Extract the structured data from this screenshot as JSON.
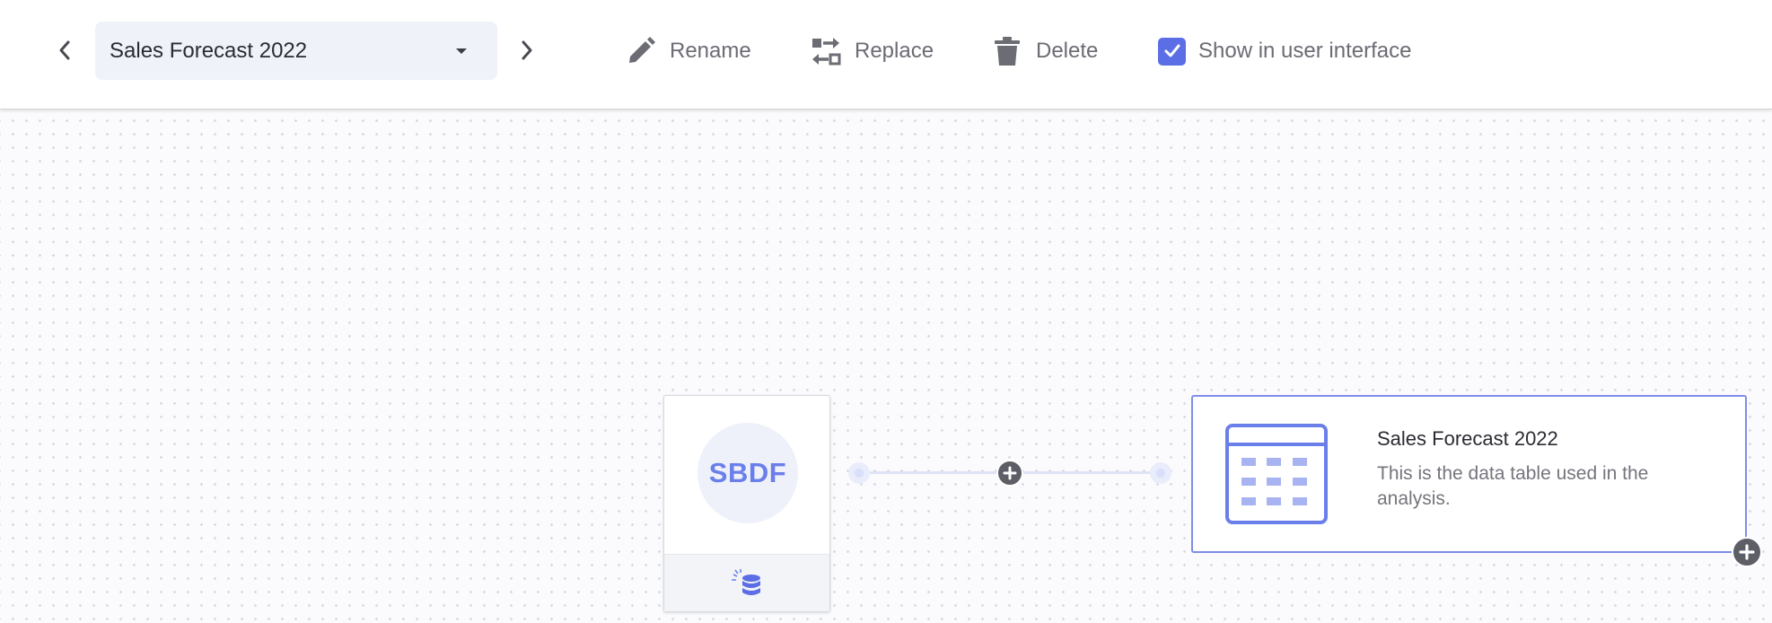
{
  "toolbar": {
    "table_selector": {
      "value": "Sales Forecast 2022"
    },
    "actions": {
      "rename": "Rename",
      "replace": "Replace",
      "delete": "Delete",
      "show_in_ui": "Show in user interface"
    },
    "show_in_ui_checked": true,
    "icons": [
      "chevron-left-icon",
      "chevron-down-icon",
      "chevron-right-icon",
      "pencil-icon",
      "replace-icon",
      "trash-icon",
      "checkbox-checked-icon"
    ]
  },
  "canvas": {
    "source_node": {
      "badge": "SBDF",
      "footer_icon": "database-icon"
    },
    "table_node": {
      "title": "Sales Forecast 2022",
      "description": "This is the data table used in the analysis.",
      "icon": "data-table-icon"
    }
  },
  "colors": {
    "accent": "#5b6ee5",
    "badge_text": "#6b7fea",
    "node_border": "#7e8ee6",
    "select_bg": "#f0f2fa",
    "icon_gray": "#6b6c74"
  }
}
